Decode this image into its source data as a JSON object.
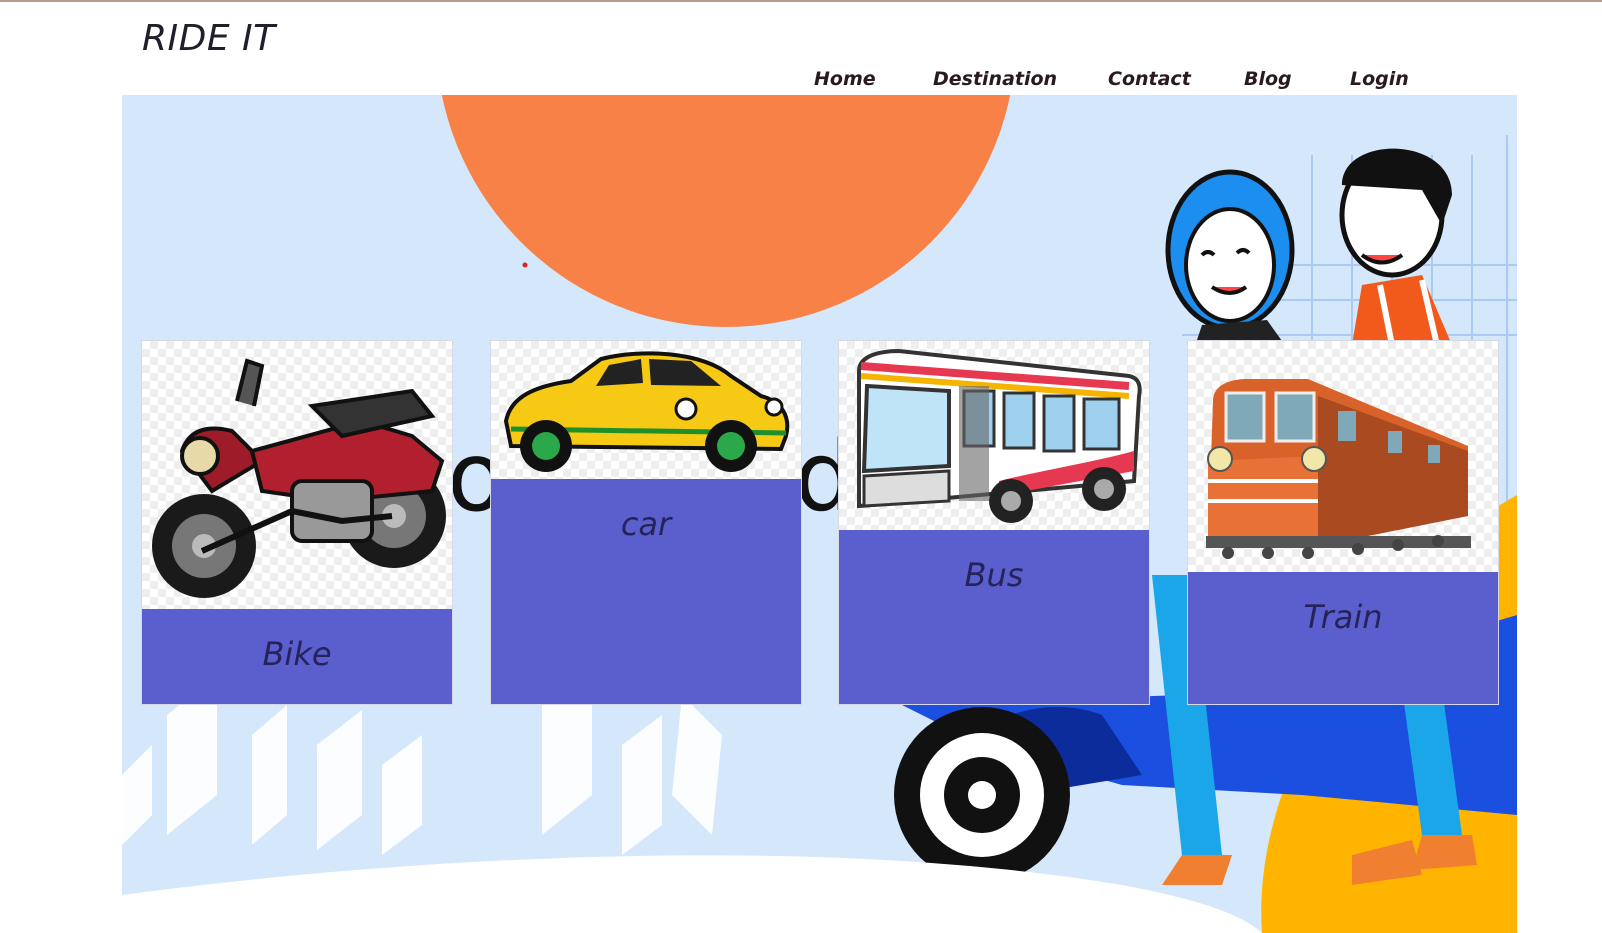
{
  "header": {
    "logo": "RIDE IT"
  },
  "nav": {
    "items": [
      {
        "label": "Home"
      },
      {
        "label": "Destination"
      },
      {
        "label": "Contact"
      },
      {
        "label": "Blog"
      },
      {
        "label": "Login"
      }
    ]
  },
  "hero": {
    "background_text_fragments": [
      "o",
      "d"
    ]
  },
  "cards": [
    {
      "label": "Bike",
      "icon": "motorbike-icon"
    },
    {
      "label": "car",
      "icon": "car-icon"
    },
    {
      "label": "Bus",
      "icon": "bus-icon"
    },
    {
      "label": "Train",
      "icon": "train-icon"
    }
  ],
  "colors": {
    "hero_background": "#d5e7fb",
    "sun": "#f78147",
    "card_label_background": "#5a5fcd",
    "card_label_text": "#25235a",
    "scooter": "#1a4fe0"
  }
}
